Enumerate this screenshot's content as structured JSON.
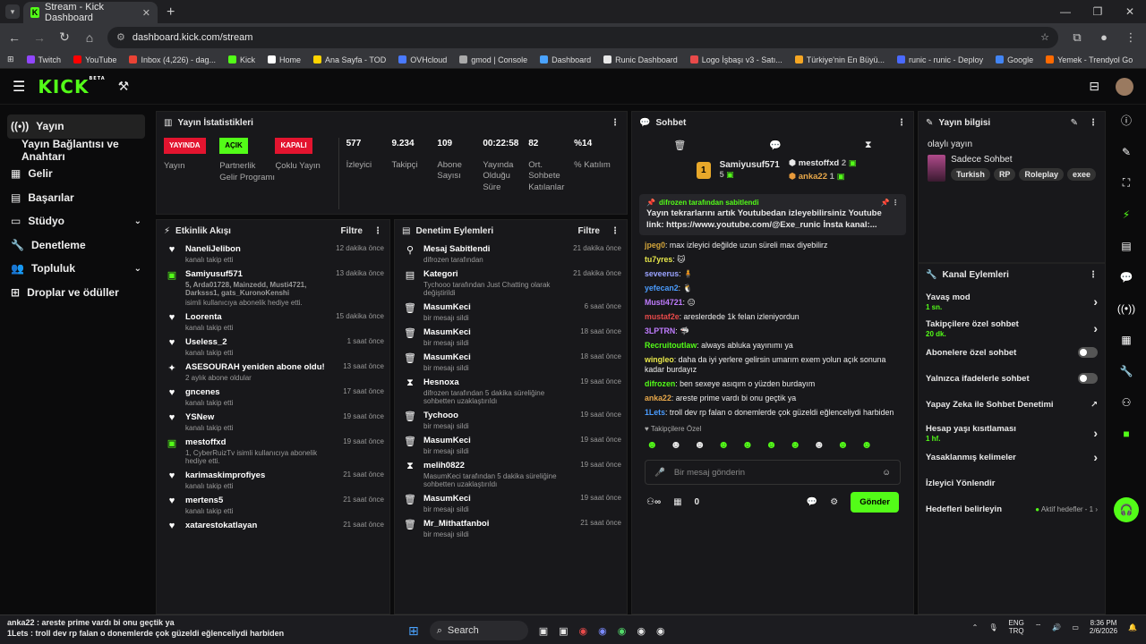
{
  "browser": {
    "tab_title": "Stream - Kick Dashboard",
    "url": "dashboard.kick.com/stream"
  },
  "bookmarks": [
    "Twitch",
    "YouTube",
    "Inbox (4,226) - dag...",
    "Kick",
    "Home",
    "Ana Sayfa - TOD",
    "OVHcloud",
    "gmod | Console",
    "Dashboard",
    "Runic Dashboard",
    "Logo İşbaşı v3 - Satı...",
    "Türkiye'nin En Büyü...",
    "runic - runic - Deploy",
    "Google",
    "Yemek - Trendyol Go"
  ],
  "sidebar": {
    "items": [
      {
        "label": "Yayın"
      },
      {
        "label": "Yayın Bağlantısı ve Anahtarı"
      },
      {
        "label": "Gelir"
      },
      {
        "label": "Başarılar"
      },
      {
        "label": "Stüdyo"
      },
      {
        "label": "Denetleme"
      },
      {
        "label": "Topluluk"
      },
      {
        "label": "Droplar ve ödüller"
      }
    ]
  },
  "stats": {
    "title": "Yayın İstatistikleri",
    "badges": [
      {
        "badge": "YAYINDA",
        "label": "Yayın",
        "color": "#e3142f"
      },
      {
        "badge": "AÇIK",
        "label": "Partnerlik Gelir Programı",
        "color": "#53fc18"
      },
      {
        "badge": "KAPALI",
        "label": "Çoklu Yayın",
        "color": "#e3142f"
      }
    ],
    "values": [
      {
        "num": "577",
        "label": "İzleyici"
      },
      {
        "num": "9.234",
        "label": "Takipçi"
      },
      {
        "num": "109",
        "label": "Abone Sayısı"
      },
      {
        "num": "00:22:58",
        "label": "Yayında Olduğu Süre"
      },
      {
        "num": "82",
        "label": "Ort. Sohbete Katılanlar"
      },
      {
        "num": "%14",
        "label": "% Katılım"
      }
    ]
  },
  "activity": {
    "title": "Etkinlik Akışı",
    "filter": "Filtre",
    "items": [
      {
        "name": "NaneliJelibon",
        "sub": "kanalı takip etti",
        "time": "12 dakika önce",
        "icon": "♥"
      },
      {
        "name": "Samiyusuf571",
        "green": "5, Arda01728, Mainzedd, Musti4721, Darksss1, gats_KuronoKenshi",
        "sub": "isimli kullanıcıya abonelik hediye etti.",
        "time": "13 dakika önce",
        "icon": "▣"
      },
      {
        "name": "Loorenta",
        "sub": "kanalı takip etti",
        "time": "15 dakika önce",
        "icon": "♥"
      },
      {
        "name": "Useless_2",
        "sub": "kanalı takip etti",
        "time": "1 saat önce",
        "icon": "♥"
      },
      {
        "name": "ASESOURAH yeniden abone oldu!",
        "sub": "2 aylık abone oldular",
        "time": "13 saat önce",
        "icon": "✦"
      },
      {
        "name": "gncenes",
        "sub": "kanalı takip etti",
        "time": "17 saat önce",
        "icon": "♥"
      },
      {
        "name": "YSNew",
        "sub": "kanalı takip etti",
        "time": "19 saat önce",
        "icon": "♥"
      },
      {
        "name": "mestoffxd",
        "sub": "1, CyberRuizTv isimli kullanıcıya abonelik hediye etti.",
        "time": "19 saat önce",
        "icon": "▣"
      },
      {
        "name": "karimaskimprofiyes",
        "sub": "kanalı takip etti",
        "time": "21 saat önce",
        "icon": "♥"
      },
      {
        "name": "mertens5",
        "sub": "kanalı takip etti",
        "time": "21 saat önce",
        "icon": "♥"
      },
      {
        "name": "xatarestokatlayan",
        "sub": "",
        "time": "21 saat önce",
        "icon": "♥"
      }
    ]
  },
  "moderation": {
    "title": "Denetim Eylemleri",
    "filter": "Filtre",
    "items": [
      {
        "name": "Mesaj Sabitlendi",
        "sub": "difrozen tarafından",
        "time": "21 dakika önce",
        "icon": "⚲"
      },
      {
        "name": "Kategori",
        "sub": "Tychooo tarafından Just Chatting olarak değiştirildi",
        "time": "21 dakika önce",
        "icon": "▤"
      },
      {
        "name": "MasumKeci",
        "sub": "bir mesajı sildi",
        "time": "6 saat önce",
        "icon": "🗑"
      },
      {
        "name": "MasumKeci",
        "sub": "bir mesajı sildi",
        "time": "18 saat önce",
        "icon": "🗑"
      },
      {
        "name": "MasumKeci",
        "sub": "bir mesajı sildi",
        "time": "18 saat önce",
        "icon": "🗑"
      },
      {
        "name": "Hesnoxa",
        "sub": "difrozen tarafından 5 dakika süreliğine sohbetten uzaklaştırıldı",
        "time": "19 saat önce",
        "icon": "⧗"
      },
      {
        "name": "Tychooo",
        "sub": "bir mesajı sildi",
        "time": "19 saat önce",
        "icon": "🗑"
      },
      {
        "name": "MasumKeci",
        "sub": "bir mesajı sildi",
        "time": "19 saat önce",
        "icon": "🗑"
      },
      {
        "name": "melih0822",
        "sub": "MasumKeci tarafından 5 dakika süreliğine sohbetten uzaklaştırıldı",
        "time": "19 saat önce",
        "icon": "⧗"
      },
      {
        "name": "MasumKeci",
        "sub": "bir mesajı sildi",
        "time": "19 saat önce",
        "icon": "🗑"
      },
      {
        "name": "Mr_Mithatfanboi",
        "sub": "bir mesajı sildi",
        "time": "21 saat önce",
        "icon": "🗑"
      }
    ]
  },
  "chat": {
    "title": "Sohbet",
    "top": [
      {
        "name": "Samiyusuf571",
        "count": "5"
      },
      {
        "name": "mestoffxd",
        "count": "2"
      },
      {
        "name": "anka22",
        "count": "1"
      }
    ],
    "pinned_by": "difrozen tarafından sabitlendi",
    "pinned_text": "Yayın tekrarlarını artık Youtubedan izleyebilirsiniz Youtube link: https://www.youtube.com/@Exe_runic İnsta kanal:...",
    "messages": [
      {
        "u": "jpeg0",
        "c": "#d4a53a",
        "t": "max izleyici değilde uzun süreli max diyebilirz"
      },
      {
        "u": "tu7yres",
        "c": "#e8e84a",
        "t": "🐱"
      },
      {
        "u": "seveerus",
        "c": "#9aa3ff",
        "t": "🧍"
      },
      {
        "u": "yefecan2",
        "c": "#4a9cff",
        "t": "🐧"
      },
      {
        "u": "Musti4721",
        "c": "#c07cff",
        "t": "😑"
      },
      {
        "u": "mustaf2e",
        "c": "#e84a4a",
        "t": "areslerdede 1k felan izleniyordun"
      },
      {
        "u": "3LPTRN",
        "c": "#c07cff",
        "t": "🦈"
      },
      {
        "u": "Recruitoutlaw",
        "c": "#53fc18",
        "t": "always abluka yayınımı ya"
      },
      {
        "u": "wingleo",
        "c": "#e8e84a",
        "t": "daha da iyi yerlere gelirsin umarım exem yolun açık sonuna kadar burdayız"
      },
      {
        "u": "difrozen",
        "c": "#53fc18",
        "t": "ben sexeye asıqım o yüzden burdayım"
      },
      {
        "u": "anka22",
        "c": "#e8a84a",
        "t": "areste prime vardı bi onu geçtik ya"
      },
      {
        "u": "1Lets",
        "c": "#4a9cff",
        "t": "troll dev rp falan o donemlerde çok güzeldi eğlenceliydi harbiden"
      }
    ],
    "followers_only": "Takipçilere Özel",
    "placeholder": "Bir mesaj gönderin",
    "send": "Gönder",
    "count": "0"
  },
  "stream_info": {
    "title": "Yayın bilgisi",
    "stream_title": "olaylı yayın",
    "category": "Sadece Sohbet",
    "tags": [
      "Turkish",
      "RP",
      "Roleplay",
      "exee"
    ]
  },
  "channel_actions": {
    "title": "Kanal Eylemleri",
    "items": [
      {
        "label": "Yavaş mod",
        "sub": "1 sn.",
        "kind": "chev"
      },
      {
        "label": "Takipçilere özel sohbet",
        "sub": "20 dk.",
        "kind": "chev"
      },
      {
        "label": "Abonelere özel sohbet",
        "sub": "",
        "kind": "toggle"
      },
      {
        "label": "Yalnızca ifadelerle sohbet",
        "sub": "",
        "kind": "toggle"
      },
      {
        "label": "Yapay Zeka ile Sohbet Denetimi",
        "sub": "",
        "kind": "ext"
      },
      {
        "label": "Hesap yaşı kısıtlaması",
        "sub": "1 hf.",
        "kind": "chev"
      },
      {
        "label": "Yasaklanmış kelimeler",
        "sub": "",
        "kind": "chev"
      },
      {
        "label": "İzleyici Yönlendir",
        "sub": "",
        "kind": "none"
      },
      {
        "label": "Hedefleri belirleyin",
        "sub": "",
        "kind": "goal"
      }
    ],
    "goal_text": "Aktif hedefler - 1"
  },
  "overlay": {
    "line1": "anka22 : areste prime vardı bi onu geçtik ya",
    "line2": "1Lets : troll dev rp falan o donemlerde çok güzeldi eğlenceliydi harbiden"
  },
  "taskbar": {
    "search": "Search",
    "lang": "ENG",
    "lang2": "TRQ",
    "time": "8:36 PM",
    "date": "2/6/2026"
  }
}
